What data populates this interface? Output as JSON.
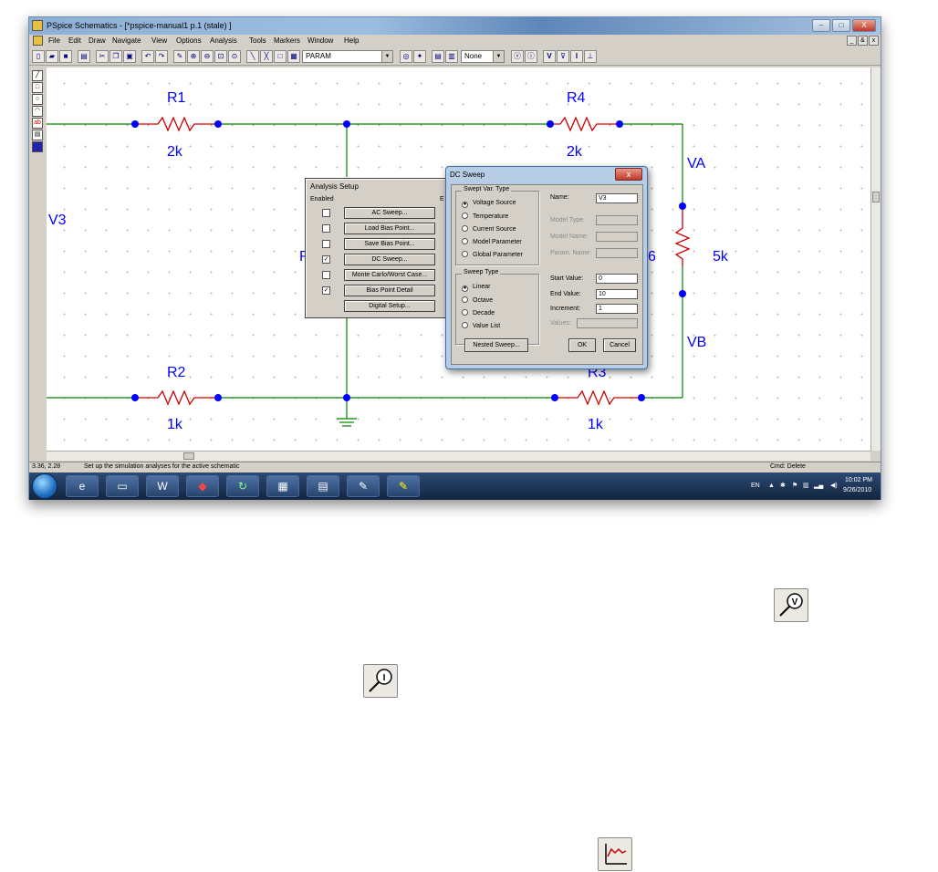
{
  "window": {
    "title": "PSpice Schematics - [*pspice-manual1  p.1 (stale) ]",
    "controls": [
      "–",
      "□",
      "X"
    ],
    "mdi_controls": [
      "_",
      "&",
      "x"
    ]
  },
  "menu": [
    "File",
    "Edit",
    "Draw",
    "Navigate",
    "View",
    "Options",
    "Analysis",
    "Tools",
    "Markers",
    "Window",
    "Help"
  ],
  "toolbar": {
    "param_select": "PARAM",
    "none_select": "None",
    "voltage_marker_label": "V",
    "current_marker_label": "I"
  },
  "schematic": {
    "labels": {
      "r1": "R1",
      "r1_value": "2k",
      "r4": "R4",
      "r4_value": "2k",
      "r2": "R2",
      "r2_value": "1k",
      "r3": "R3",
      "r3_value": "1k",
      "v3": "V3",
      "va": "VA",
      "vb": "VB",
      "r6_suffix": "6",
      "r6_value": "5k",
      "r5_partial": "R"
    }
  },
  "analysis_setup": {
    "title": "Analysis Setup",
    "enabled_header": "Enabled",
    "partial_header": "E",
    "rows": [
      {
        "label": "AC Sweep...",
        "check": ""
      },
      {
        "label": "Load Bias Point...",
        "check": ""
      },
      {
        "label": "Save Bias Point...",
        "check": ""
      },
      {
        "label": "DC Sweep...",
        "check": "✓"
      },
      {
        "label": "Monte Carlo/Worst Case...",
        "check": ""
      },
      {
        "label": "Bias Point Detail",
        "check": "✓"
      },
      {
        "label": "Digital Setup...",
        "check": ""
      }
    ]
  },
  "dc_sweep": {
    "title": "DC Sweep",
    "close": "x",
    "var_type_title": "Swept Var. Type",
    "var_types": [
      {
        "label": "Voltage Source",
        "dot": "●"
      },
      {
        "label": "Temperature",
        "dot": ""
      },
      {
        "label": "Current Source",
        "dot": ""
      },
      {
        "label": "Model Parameter",
        "dot": ""
      },
      {
        "label": "Global Parameter",
        "dot": ""
      }
    ],
    "sweep_type_title": "Sweep Type",
    "sweep_types": [
      {
        "label": "Linear",
        "dot": "●"
      },
      {
        "label": "Octave",
        "dot": ""
      },
      {
        "label": "Decade",
        "dot": ""
      },
      {
        "label": "Value List",
        "dot": ""
      }
    ],
    "name_label": "Name:",
    "name_value": "V3",
    "model_type_label": "Model Type:",
    "model_name_label": "Model Name:",
    "param_name_label": "Param. Name:",
    "start_label": "Start Value:",
    "start_value": "0",
    "end_label": "End Value:",
    "end_value": "10",
    "inc_label": "Increment:",
    "inc_value": "1",
    "values_label": "Values:",
    "nested_button": "Nested Sweep...",
    "ok_button": "OK",
    "cancel_button": "Cancel"
  },
  "status": {
    "coords": "3.36,  2.28",
    "message": "Set up the simulation analyses for the active schematic",
    "cmd": "Cmd: Delete"
  },
  "taskbar": {
    "lang": "EN",
    "time": "10:02 PM",
    "date": "9/26/2010"
  }
}
